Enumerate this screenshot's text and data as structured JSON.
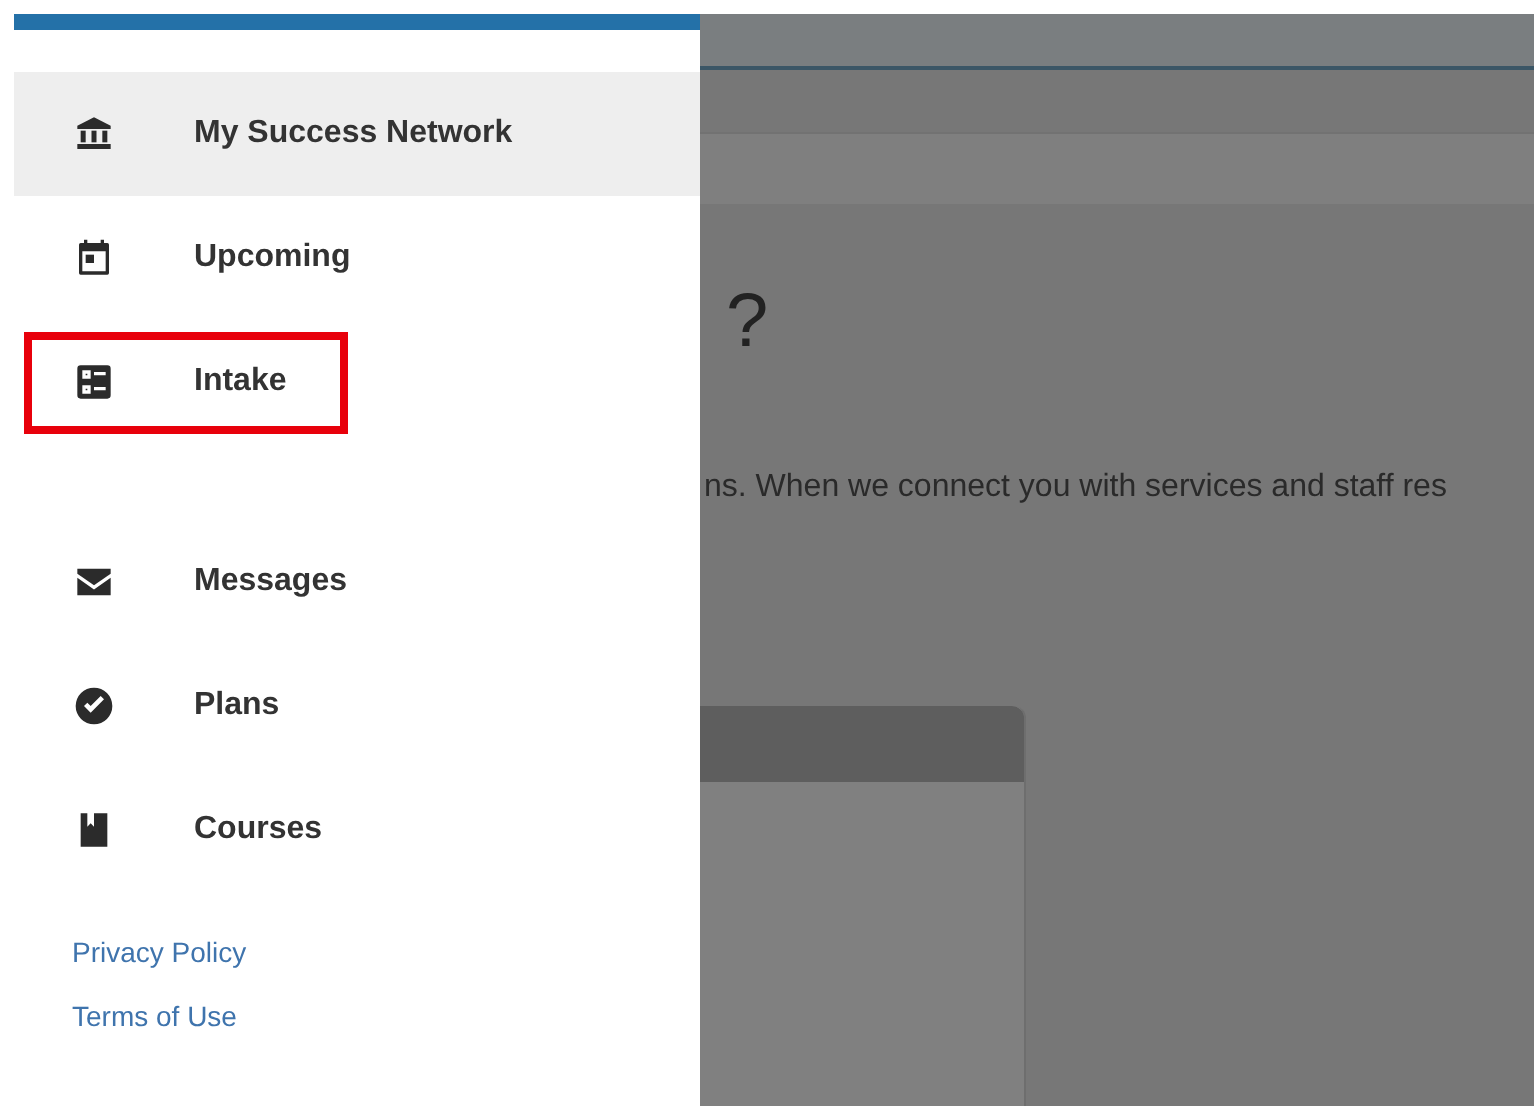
{
  "sidebar": {
    "groups": [
      {
        "items": [
          {
            "label": "My Success Network",
            "selected": true,
            "highlighted": false
          },
          {
            "label": "Upcoming",
            "selected": false,
            "highlighted": false
          },
          {
            "label": "Intake",
            "selected": false,
            "highlighted": true
          }
        ]
      },
      {
        "items": [
          {
            "label": "Messages",
            "selected": false,
            "highlighted": false
          },
          {
            "label": "Plans",
            "selected": false,
            "highlighted": false
          },
          {
            "label": "Courses",
            "selected": false,
            "highlighted": false
          }
        ]
      }
    ],
    "links": [
      "Privacy Policy",
      "Terms of Use"
    ]
  },
  "background_page": {
    "heading": "?",
    "paragraph": "ns. When we connect you with services and staff res"
  }
}
